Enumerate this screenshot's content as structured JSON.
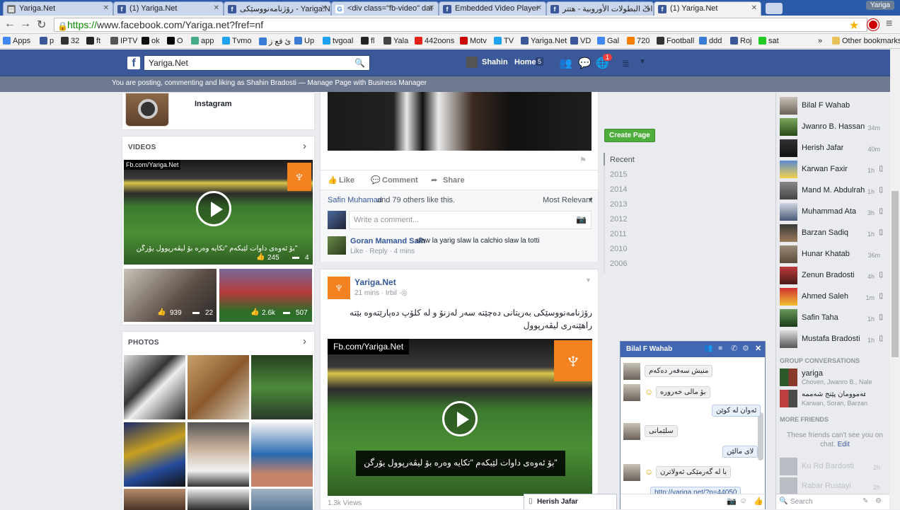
{
  "browser": {
    "tabs": [
      {
        "label": "Yariga.Net",
        "icon": "page-icon"
      },
      {
        "label": "(1) Yariga.Net",
        "icon": "facebook-icon"
      },
      {
        "label": "رۆژنامەنووسێکی - Yariga.Net",
        "icon": "facebook-icon"
      },
      {
        "label": "<div class=\"fb-video\" dat",
        "icon": "google-icon"
      },
      {
        "label": "Embedded Video Player",
        "icon": "facebook-icon"
      },
      {
        "label": "أهداف البطولات الأوروبية - هتتر",
        "icon": "facebook-icon"
      },
      {
        "label": "(1) Yariga.Net",
        "icon": "facebook-icon"
      }
    ],
    "user_badge": "Yariga",
    "url_scheme": "https://",
    "url_rest": "www.facebook.com/Yariga.net?fref=nf",
    "bookmarks": [
      "Apps",
      "p",
      "32",
      "ft",
      "IPTV",
      "ok",
      "O",
      "app",
      "Tvmo",
      "ئ قع ز",
      "Up",
      "tvgoal",
      "fl",
      "Yala",
      "442oons",
      "Motv",
      "TV",
      "Yariga.Net",
      "VD",
      "Gal",
      "720",
      "Football",
      "ddd",
      "Roj",
      "sat"
    ],
    "other_bookmarks": "Other bookmarks"
  },
  "fb": {
    "search_value": "Yariga.Net",
    "user_name": "Shahin",
    "home_label": "Home",
    "home_count": "5",
    "notif_count": "1",
    "notice_text": "You are posting, commenting and liking as Shahin Bradosti — Manage Page with Business Manager"
  },
  "left": {
    "instagram_label": "Instagram",
    "videos_title": "VIDEOS",
    "video_main_tag": "Fb.com/Yariga.Net",
    "video_main_caption": "\"بۆ ئەوەی داوات لێبکەم \"تکایە وەرە بۆ لیڤەرپوول یۆرگن",
    "video_main_likes": "245",
    "video_main_comments": "4",
    "video2_likes": "939",
    "video2_comments": "22",
    "video3_likes": "2.6k",
    "video3_comments": "507",
    "photos_title": "PHOTOS"
  },
  "post1": {
    "like_label": "Like",
    "comment_label": "Comment",
    "share_label": "Share",
    "likers_name": "Safin Muhamad",
    "likers_rest": " and 79 others like this.",
    "sort_label": "Most Relevant",
    "comment_placeholder": "Write a comment...",
    "commenter": "Goran Mamand Salh",
    "comment_text": "slaw la yarig slaw la calchio slaw la totti",
    "comment_meta": "Like · Reply · 4 mins"
  },
  "post2": {
    "page_name": "Yariga.Net",
    "meta": "21 mins · Irbil ·",
    "body": "رۆژنامەنووسێکی بەریتانی دەچێتە سەر لەزنۆ و لە کلۆپ دەپارێتەوە بێتە راهێنەری لیڤەرپوول",
    "video_tag": "Fb.com/Yariga.Net",
    "video_caption": "\"بۆ ئەوەی داوات لێبکەم \"تکایە وەرە بۆ لیڤەرپوول یۆرگن",
    "views": "1.3k Views"
  },
  "timeline": {
    "create_page": "Create Page",
    "years": [
      "Recent",
      "2015",
      "2014",
      "2013",
      "2012",
      "2011",
      "2010",
      "2006"
    ]
  },
  "chat": {
    "friends": [
      {
        "name": "Bilal F Wahab",
        "time": ""
      },
      {
        "name": "Jwanro B. Hassan",
        "time": "34m"
      },
      {
        "name": "Herish Jafar",
        "time": "40m"
      },
      {
        "name": "Karwan Faxir",
        "time": "1h"
      },
      {
        "name": "Mand M. Abdulrah...",
        "time": "1h"
      },
      {
        "name": "Muhammad Ata",
        "time": "3h"
      },
      {
        "name": "Barzan Sadiq",
        "time": "1h"
      },
      {
        "name": "Hunar Khatab",
        "time": "36m"
      },
      {
        "name": "Zenun Bradosti",
        "time": "4h"
      },
      {
        "name": "Ahmed Saleh",
        "time": "1m"
      },
      {
        "name": "Safin Taha",
        "time": "1h"
      },
      {
        "name": "Mustafa Bradosti",
        "time": "1h"
      }
    ],
    "group_title": "GROUP CONVERSATIONS",
    "groups": [
      {
        "name": "yariga",
        "members": "Choven, Jwanro B., Nale"
      },
      {
        "name": "هەموومان پێنج شەممە",
        "members": "Karwan, Soran, Barzan"
      }
    ],
    "more_friends": "MORE FRIENDS",
    "more_note": "These friends can't see you on chat.",
    "edit_label": "Edit",
    "offline": [
      "Ku Rd Bardosti",
      "Rabar Rustayi"
    ],
    "offline_times": [
      "2h",
      "2h"
    ],
    "search_placeholder": "Search",
    "window_name": "Bilal F Wahab",
    "messages": [
      {
        "text": "منیش سەفەر دەکەم",
        "me": false
      },
      {
        "text": "بۆ مالی خەرورە",
        "me": false
      },
      {
        "text": "ئەوان لە کوێن",
        "me": true
      },
      {
        "text": "سلێمانی",
        "me": false
      },
      {
        "text": "لای مالێن",
        "me": true
      },
      {
        "text": "با لە گەرمێکی ئەولاترن",
        "me": false
      },
      {
        "text": "http://yariga.net/?p=44050",
        "me": true
      }
    ],
    "tab2_name": "Herish Jafar"
  }
}
